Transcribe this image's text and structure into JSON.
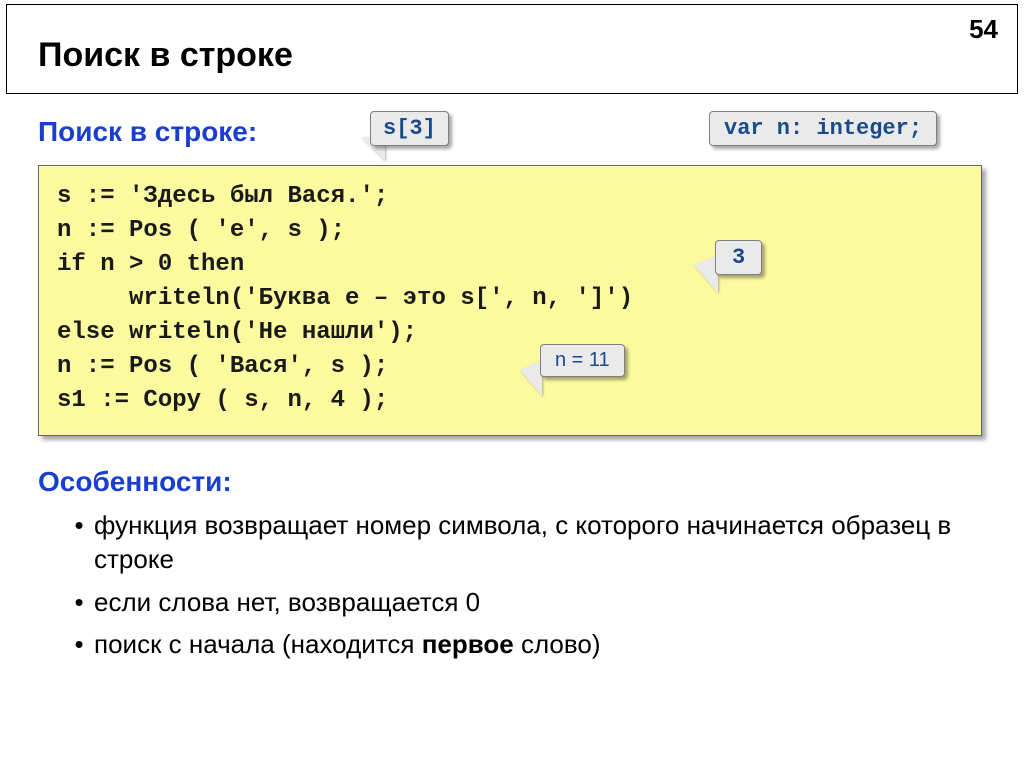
{
  "page_number": "54",
  "title": "Поиск в строке",
  "section_search": "Поиск в строке:",
  "callout_s3": "s[3]",
  "callout_var": "var n: integer;",
  "code": {
    "l1": "s := 'Здесь был Вася.';",
    "l2": "n := Pos ( 'е', s );",
    "l3": "if n > 0 then",
    "l4": "     writeln('Буква е – это s[', n, ']')",
    "l5": "else writeln('Не нашли');",
    "l6": "n := Pos ( 'Вася', s );",
    "l7": "s1 := Copy ( s, n, 4 );"
  },
  "callout_3": "3",
  "callout_n11": "n = 11",
  "section_features": "Особенности:",
  "bullets": {
    "b1": "функция возвращает номер символа, с которого начинается образец в строке",
    "b2": "если слова нет, возвращается 0",
    "b3_a": "поиск с начала (находится ",
    "b3_b": "первое",
    "b3_c": " слово)"
  }
}
